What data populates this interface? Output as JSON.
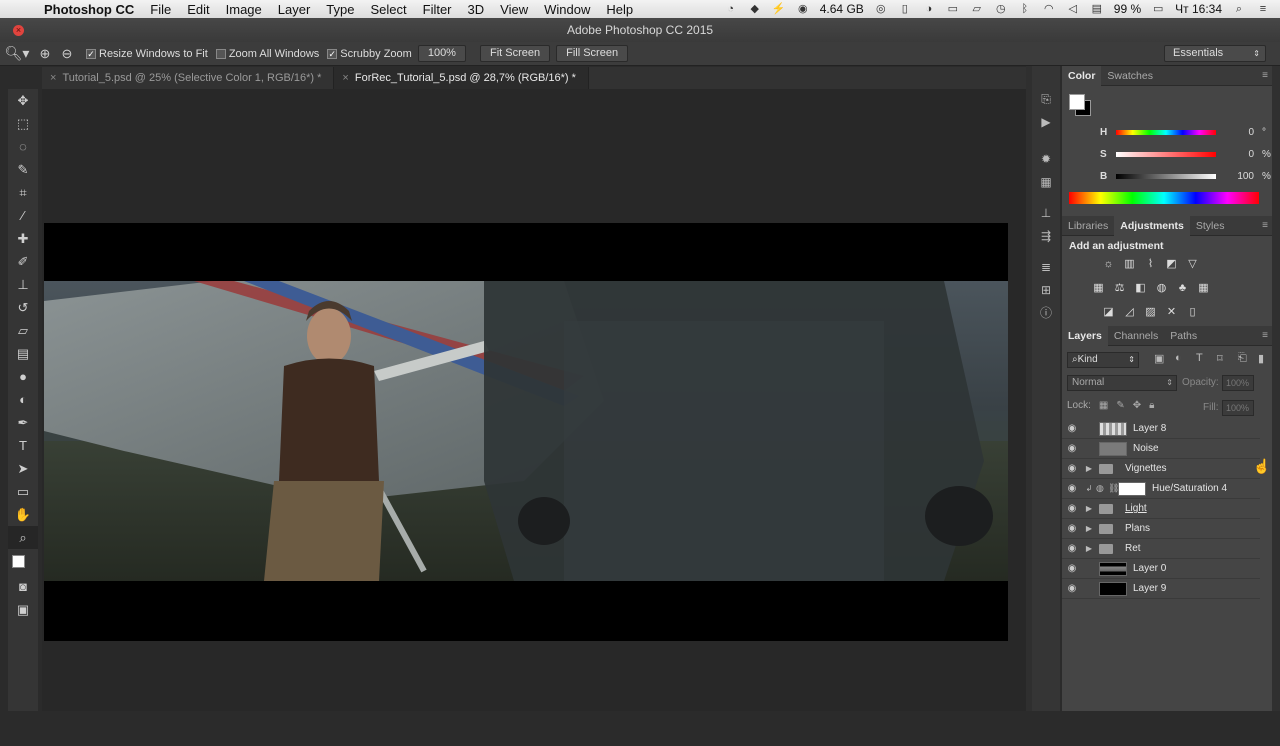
{
  "menubar": {
    "app_name": "Photoshop CC",
    "items": [
      "File",
      "Edit",
      "Image",
      "Layer",
      "Type",
      "Select",
      "Filter",
      "3D",
      "View",
      "Window",
      "Help"
    ],
    "memory": "4.64 GB",
    "battery": "99 %",
    "time": "Чт 16:34"
  },
  "window": {
    "title": "Adobe Photoshop CC 2015"
  },
  "options": {
    "resize_windows": "Resize Windows to Fit",
    "zoom_all": "Zoom All Windows",
    "scrubby": "Scrubby Zoom",
    "zoom_100": "100%",
    "fit_screen": "Fit Screen",
    "fill_screen": "Fill Screen",
    "workspace": "Essentials"
  },
  "tabs": [
    {
      "label": "Tutorial_5.psd @ 25% (Selective Color 1, RGB/16*) *"
    },
    {
      "label": "ForRec_Tutorial_5.psd @ 28,7% (RGB/16*) *"
    }
  ],
  "color_panel": {
    "tabs": [
      "Color",
      "Swatches"
    ],
    "h_label": "H",
    "h_value": "0",
    "h_unit": "°",
    "s_label": "S",
    "s_value": "0",
    "s_unit": "%",
    "b_label": "B",
    "b_value": "100",
    "b_unit": "%"
  },
  "adj_panel": {
    "tabs": [
      "Libraries",
      "Adjustments",
      "Styles"
    ],
    "title": "Add an adjustment"
  },
  "layers_panel": {
    "tabs": [
      "Layers",
      "Channels",
      "Paths"
    ],
    "filter": "Kind",
    "blend_mode": "Normal",
    "opacity_label": "Opacity:",
    "opacity_value": "100%",
    "lock_label": "Lock:",
    "fill_label": "Fill:",
    "fill_value": "100%",
    "layers": [
      {
        "name": "Layer 8"
      },
      {
        "name": "Noise"
      },
      {
        "name": "Vignettes"
      },
      {
        "name": "Hue/Saturation 4"
      },
      {
        "name": "Light"
      },
      {
        "name": "Plans"
      },
      {
        "name": "Ret"
      },
      {
        "name": "Layer 0"
      },
      {
        "name": "Layer 9"
      }
    ]
  }
}
